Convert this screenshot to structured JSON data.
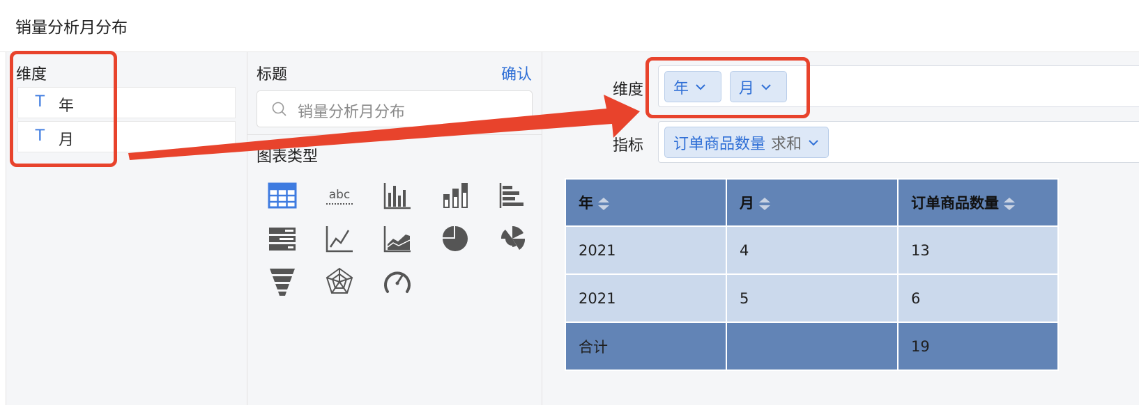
{
  "header": {
    "title": "销量分析月分布"
  },
  "left_panel": {
    "heading": "维度",
    "fields": [
      {
        "type_icon": "T",
        "label": "年"
      },
      {
        "type_icon": "T",
        "label": "月"
      }
    ]
  },
  "middle_panel": {
    "title_label": "标题",
    "confirm_label": "确认",
    "search_value": "销量分析月分布",
    "chart_type_label": "图表类型",
    "chart_types": [
      "table-icon",
      "text-icon",
      "vertical-bar-icon",
      "stacked-bar-icon",
      "horizontal-bar-icon",
      "strip-bar-icon",
      "line-icon",
      "area-icon",
      "pie-icon",
      "rose-icon",
      "funnel-icon",
      "radar-icon",
      "gauge-icon"
    ]
  },
  "right_panel": {
    "dimension_label": "维度",
    "dimension_tags": [
      "年",
      "月"
    ],
    "metric_label": "指标",
    "metric_tags": [
      {
        "name": "订单商品数量",
        "agg": "求和"
      }
    ]
  },
  "table": {
    "headers": [
      "年",
      "月",
      "订单商品数量"
    ],
    "rows": [
      [
        "2021",
        "4",
        "13"
      ],
      [
        "2021",
        "5",
        "6"
      ]
    ],
    "total_row": [
      "合计",
      "",
      "19"
    ]
  },
  "colors": {
    "accent": "#2f6fd6",
    "header_fill": "#6284b6",
    "cell_fill": "#cbd9ec",
    "annotation": "#e8432c"
  }
}
